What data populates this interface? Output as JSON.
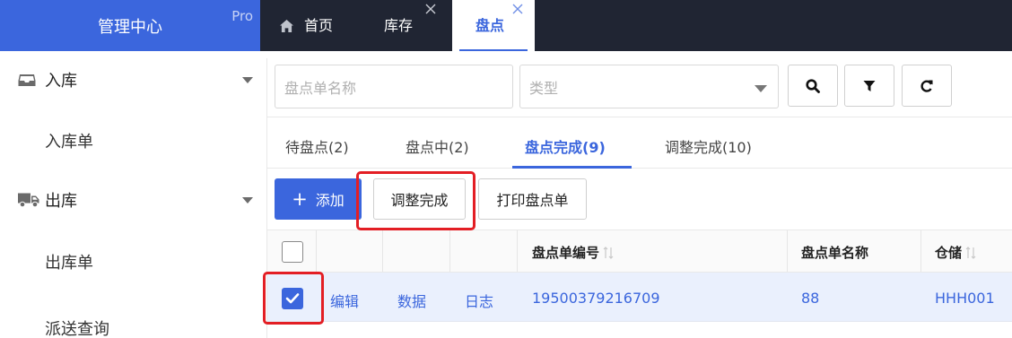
{
  "brand": {
    "title": "管理中心",
    "badge": "Pro"
  },
  "top_tabs": [
    {
      "label": "首页",
      "icon": "home-icon"
    },
    {
      "label": "库存",
      "closable": true
    },
    {
      "label": "盘点",
      "closable": true,
      "active": true
    }
  ],
  "sidebar": {
    "groups": [
      {
        "label": "入库",
        "icon": "inbox-icon",
        "items": [
          "入库单"
        ]
      },
      {
        "label": "出库",
        "icon": "truck-icon",
        "items": [
          "出库单",
          "派送查询"
        ]
      }
    ]
  },
  "search": {
    "name_placeholder": "盘点单名称",
    "type_placeholder": "类型",
    "buttons": [
      "search-icon",
      "filter-icon",
      "refresh-icon"
    ]
  },
  "status_tabs": [
    {
      "label": "待盘点(2)"
    },
    {
      "label": "盘点中(2)"
    },
    {
      "label": "盘点完成(9)",
      "active": true
    },
    {
      "label": "调整完成(10)"
    }
  ],
  "toolbar": {
    "add_label": "添加",
    "adjust_label": "调整完成",
    "print_label": "打印盘点单"
  },
  "table": {
    "columns": [
      "盘点单编号",
      "盘点单名称",
      "仓储"
    ],
    "rows": [
      {
        "checked": true,
        "actions": [
          "编辑",
          "数据",
          "日志"
        ],
        "code": "19500379216709",
        "name": "88",
        "warehouse": "HHH001"
      }
    ]
  },
  "colors": {
    "primary": "#3b66dd",
    "topbar": "#202533",
    "row_selected": "#eaf0fd",
    "highlight": "#e31e24"
  }
}
